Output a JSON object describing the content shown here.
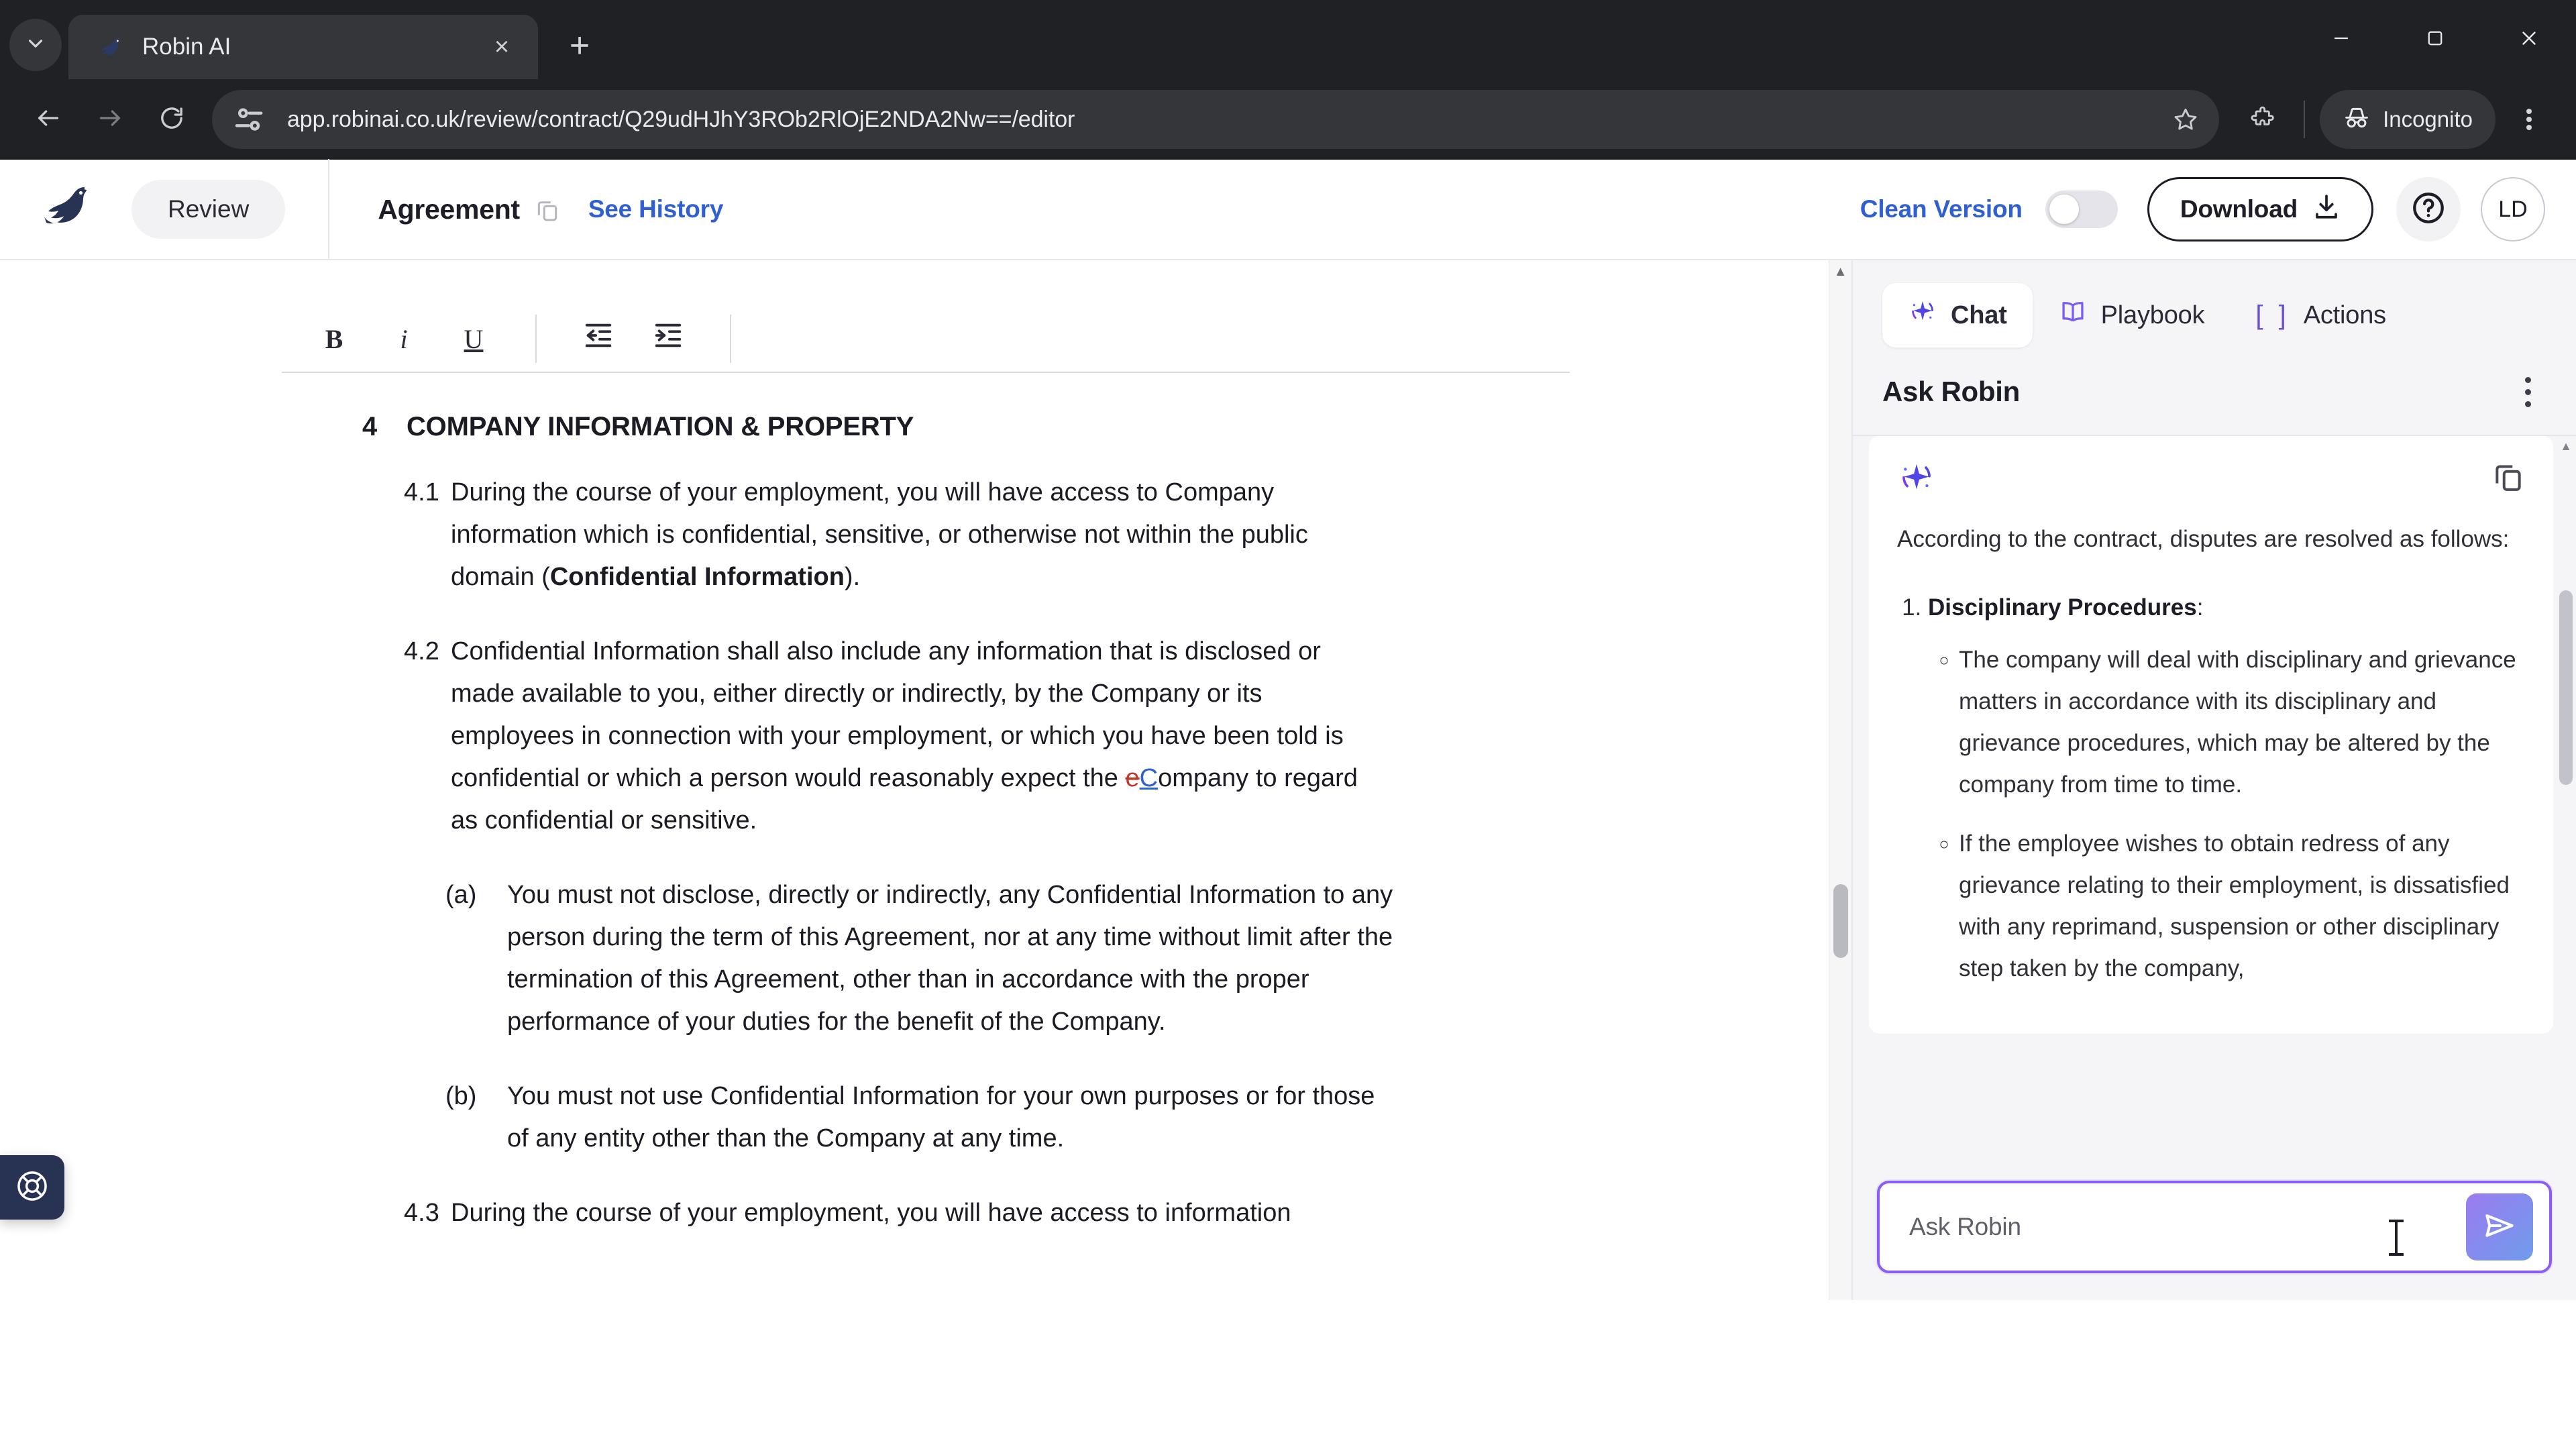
{
  "browser": {
    "tab": {
      "title": "Robin AI",
      "favicon": "robin-bird-icon",
      "close": "×"
    },
    "newtab_label": "+",
    "tab_search_icon": "chevron-down-icon",
    "nav": {
      "back": "back-arrow-icon",
      "forward": "forward-arrow-icon",
      "reload": "reload-icon"
    },
    "omnibox": {
      "site_icon": "page-info-icon",
      "url": "app.robinai.co.uk/review/contract/Q29udHJhY3ROb2RlOjE2NDA2Nw==/editor",
      "bookmark_icon": "star-icon"
    },
    "extensions_icon": "puzzle-piece-icon",
    "incognito": {
      "label": "Incognito",
      "icon": "incognito-icon"
    },
    "menu_icon": "three-dot-menu-icon",
    "window": {
      "minimize": "minimize-icon",
      "maximize": "maximize-icon",
      "close": "close-icon"
    }
  },
  "app_header": {
    "logo": "robin-bird-logo",
    "review_label": "Review",
    "document_name": "Agreement",
    "copy_icon": "copy-icon",
    "see_history_label": "See History",
    "clean_version_label": "Clean Version",
    "clean_version_on": false,
    "download_label": "Download",
    "download_icon": "download-icon",
    "help_icon": "question-circle-icon",
    "avatar_initials": "LD"
  },
  "editor": {
    "toolbar": {
      "bold": "B",
      "italic": "i",
      "underline": "U",
      "outdent_icon": "outdent-icon",
      "indent_icon": "indent-icon"
    },
    "heading": {
      "number": "4",
      "text": "COMPANY INFORMATION & PROPERTY"
    },
    "clauses": [
      {
        "number": "4.1",
        "level": "main",
        "segments": [
          {
            "type": "text",
            "text": "During the course of your employment, you will have access to Company information which is confidential, sensitive, or otherwise not within the public domain ("
          },
          {
            "type": "bold",
            "text": "Confidential Information"
          },
          {
            "type": "text",
            "text": ")."
          }
        ]
      },
      {
        "number": "4.2",
        "level": "main",
        "segments": [
          {
            "type": "text",
            "text": "Confidential Information shall also include any information that is disclosed or made available to you, either directly or indirectly, by the Company or its employees in connection with your employment, or which you have been told is confidential or which a person would reasonably expect the "
          },
          {
            "type": "deleted",
            "text": "e"
          },
          {
            "type": "inserted",
            "text": "C"
          },
          {
            "type": "text",
            "text": "ompany to regard as confidential or sensitive."
          }
        ]
      },
      {
        "number": "(a)",
        "level": "sub",
        "segments": [
          {
            "type": "text",
            "text": "You must not disclose, directly or indirectly, any Confidential Information to any person during the term of this Agreement, nor at any time without limit after the termination of this Agreement, other than in accordance with the proper performance of your duties for the benefit of the Company."
          }
        ]
      },
      {
        "number": "(b)",
        "level": "sub",
        "segments": [
          {
            "type": "text",
            "text": "You must not use Confidential Information for your own purposes or for those of any entity other than the Company at any time."
          }
        ]
      },
      {
        "number": "4.3",
        "level": "main",
        "segments": [
          {
            "type": "text",
            "text": "During the course of your employment, you will have access to information"
          }
        ]
      }
    ],
    "help_fab_icon": "lifebuoy-icon"
  },
  "chat_panel": {
    "tabs": [
      {
        "label": "Chat",
        "icon": "sparkle-icon",
        "active": true
      },
      {
        "label": "Playbook",
        "icon": "book-icon",
        "active": false
      },
      {
        "label": "Actions",
        "icon": "brackets-icon",
        "active": false
      }
    ],
    "title": "Ask Robin",
    "menu_icon": "three-dot-menu-icon",
    "message": {
      "avatar_icon": "sparkle-icon",
      "copy_icon": "copy-icon",
      "intro": "According to the contract, disputes are resolved as follows:",
      "items": [
        {
          "number": "1.",
          "heading": "Disciplinary Procedures",
          "heading_suffix": ":",
          "bullets": [
            "The company will deal with disciplinary and grievance matters in accordance with its disciplinary and grievance procedures, which may be altered by the company from time to time.",
            "If the employee wishes to obtain redress of any grievance relating to their employment, is dissatisfied with any reprimand, suspension or other disciplinary step taken by the company,"
          ]
        }
      ]
    },
    "composer": {
      "placeholder": "Ask Robin",
      "value": "",
      "send_icon": "send-icon"
    }
  },
  "colors": {
    "accent_blue": "#2f5fd0",
    "accent_purple": "#8b5cf6",
    "insert_blue": "#2f5fd0",
    "delete_red": "#c0392b",
    "chrome_dark": "#202124",
    "panel_bg": "#f5f5f8"
  }
}
